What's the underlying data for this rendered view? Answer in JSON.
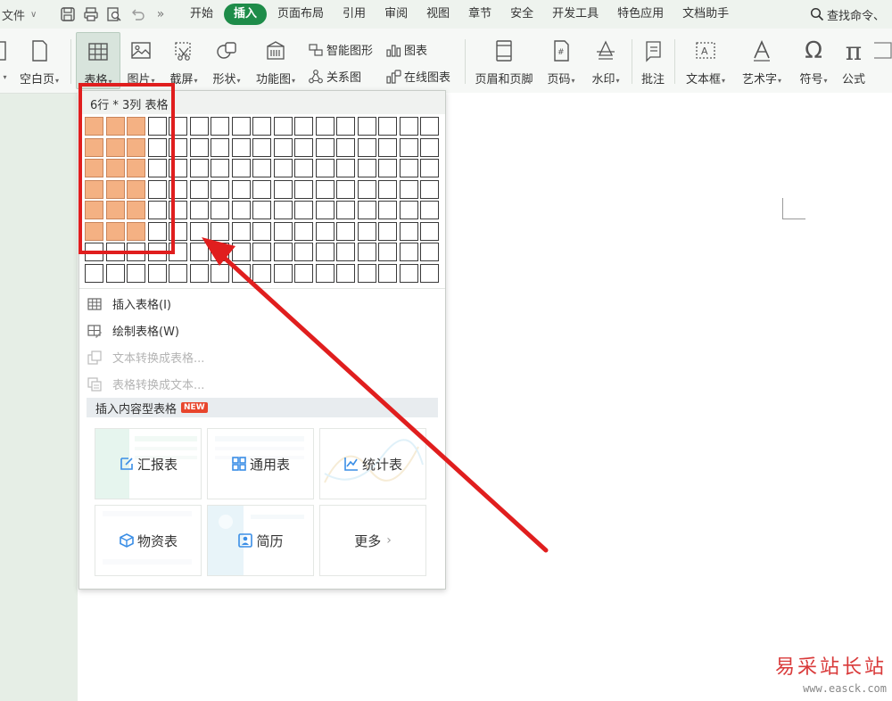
{
  "menubar": {
    "file_label": "文件",
    "tabs": [
      {
        "label": "开始"
      },
      {
        "label": "插入",
        "active": true
      },
      {
        "label": "页面布局"
      },
      {
        "label": "引用"
      },
      {
        "label": "审阅"
      },
      {
        "label": "视图"
      },
      {
        "label": "章节"
      },
      {
        "label": "安全"
      },
      {
        "label": "开发工具"
      },
      {
        "label": "特色应用"
      },
      {
        "label": "文档助手"
      }
    ],
    "search_label": "查找命令、"
  },
  "ribbon": {
    "blank_page": "空白页",
    "table": "表格",
    "picture": "图片",
    "screenshot": "截屏",
    "shape": "形状",
    "function_chart": "功能图",
    "smart_shape": "智能图形",
    "chart": "图表",
    "relation_chart": "关系图",
    "online_chart": "在线图表",
    "header_footer": "页眉和页脚",
    "page_number": "页码",
    "watermark": "水印",
    "comment": "批注",
    "textbox": "文本框",
    "wordart": "艺术字",
    "symbol": "符号",
    "formula": "公式"
  },
  "table_dropdown": {
    "header": "6行 * 3列 表格",
    "grid": {
      "rows": 8,
      "cols": 17,
      "selected_rows": 6,
      "selected_cols": 3
    },
    "colors": {
      "selected": "#f4b183",
      "accent": "#1e8c49"
    },
    "menu": {
      "insert_table": "插入表格(I)",
      "draw_table": "绘制表格(W)",
      "text_to_table": "文本转换成表格...",
      "table_to_text": "表格转换成文本..."
    },
    "content_section": {
      "label": "插入内容型表格",
      "badge": "NEW"
    },
    "cards": {
      "report": "汇报表",
      "general": "通用表",
      "stats": "统计表",
      "materials": "物资表",
      "resume": "简历",
      "more": "更多"
    }
  },
  "annotation": {
    "highlight_color": "#e01e1e"
  },
  "watermark": {
    "title": "易采站长站",
    "url": "www.easck.com"
  }
}
